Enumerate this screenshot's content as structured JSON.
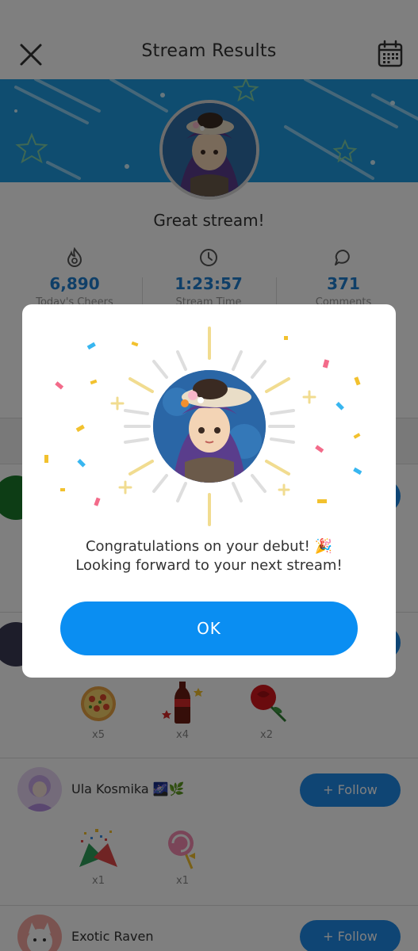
{
  "header": {
    "title": "Stream Results",
    "close_icon": "close-icon",
    "calendar_icon": "calendar-icon"
  },
  "greeting": "Great stream!",
  "stats": [
    {
      "icon": "flame-icon",
      "value": "6,890",
      "label": "Today's Cheers"
    },
    {
      "icon": "clock-icon",
      "value": "1:23:57",
      "label": "Stream Time"
    },
    {
      "icon": "comment-icon",
      "value": "371",
      "label": "Comments"
    }
  ],
  "viewers": [
    {
      "name": "Ula Kosmika 🌌🌿",
      "follow_label": "+ Follow",
      "gifts": [
        {
          "icon": "party-popper-icon",
          "count": "x1"
        },
        {
          "icon": "lollipop-icon",
          "count": "x1"
        }
      ]
    },
    {
      "name": "Exotic Raven",
      "follow_label": "+ Follow"
    }
  ],
  "hidden_gifts": [
    {
      "icon": "pizza-icon",
      "count": "x5"
    },
    {
      "icon": "cola-icon",
      "count": "x4"
    },
    {
      "icon": "rose-icon",
      "count": "x2"
    }
  ],
  "modal": {
    "line1": "Congratulations on your debut! 🎉",
    "line2": "Looking forward to your next stream!",
    "ok_label": "OK"
  },
  "colors": {
    "accent": "#0a8ef2",
    "banner": "#1f9be0",
    "follow": "#1f8ae8",
    "stat_value": "#1f7fd0"
  }
}
